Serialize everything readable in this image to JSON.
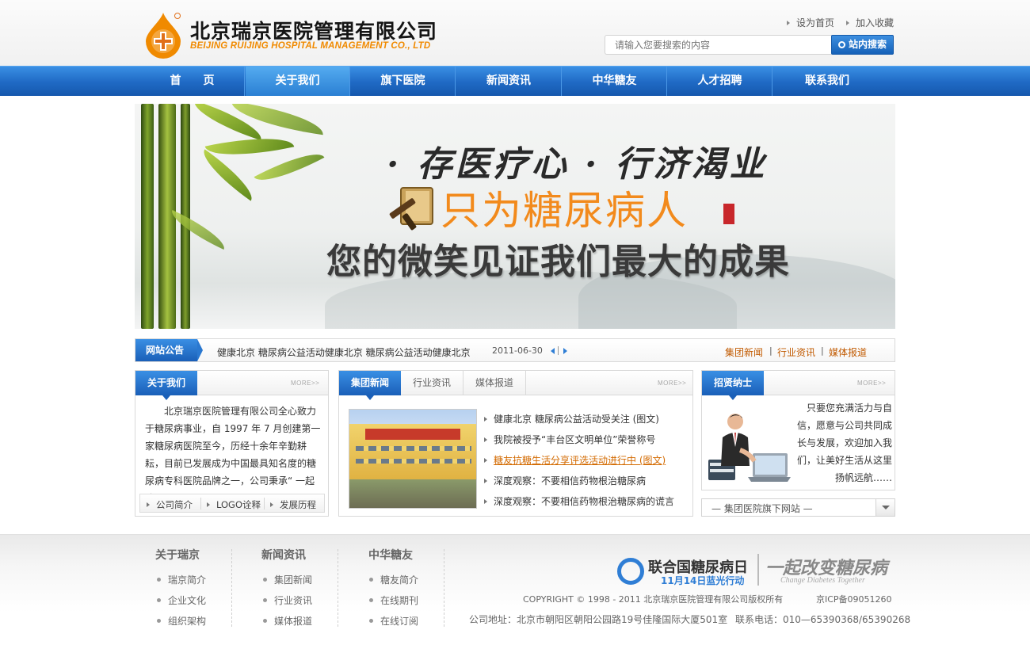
{
  "header": {
    "logo_cn": "北京瑞京医院管理有限公司",
    "logo_en": "BEIJING RUIJING HOSPITAL MANAGEMENT CO., LTD",
    "set_home": "设为首页",
    "bookmark": "加入收藏",
    "search_placeholder": "请输入您要搜索的内容",
    "search_button": "站内搜索"
  },
  "nav": [
    {
      "label": "首　　页"
    },
    {
      "label": "关于我们"
    },
    {
      "label": "旗下医院"
    },
    {
      "label": "新闻资讯"
    },
    {
      "label": "中华糖友"
    },
    {
      "label": "人才招聘"
    },
    {
      "label": "联系我们"
    }
  ],
  "nav_active_index": 1,
  "banner": {
    "line1": "· 存医疗心 · 行济渴业",
    "line2": "只为糖尿病人",
    "line3": "您的微笑见证我们最大的成果"
  },
  "notice": {
    "label": "网站公告",
    "text": "健康北京 糖尿病公益活动健康北京 糖尿病公益活动健康北京",
    "date": "2011-06-30",
    "links": [
      "集团新闻",
      "行业资讯",
      "媒体报道"
    ]
  },
  "about": {
    "title": "关于我们",
    "more": "MORE>>",
    "text": "北京瑞京医院管理有限公司全心致力于糖尿病事业，自 1997 年 7 月创建第一家糖尿病医院至今，历经十余年辛勤耕耘，目前已发展成为中国最具知名度的糖尿病专科医院品牌之一，公司秉承“ 一起改 . . .",
    "links": [
      "公司简介",
      "LOGO诠释",
      "发展历程"
    ]
  },
  "news": {
    "tabs": [
      "集团新闻",
      "行业资讯",
      "媒体报道"
    ],
    "more": "MORE>>",
    "items": [
      "健康北京 糖尿病公益活动受关注 (图文)",
      "我院被授予“丰台区文明单位”荣誉称号",
      "糖友抗糖生活分享评选活动进行中 (图文)",
      "深度观察：不要相信药物根治糖尿病",
      "深度观察：不要相信药物根治糖尿病的谎言"
    ],
    "highlight_index": 2
  },
  "recruit": {
    "title": "招贤纳士",
    "more": "MORE>>",
    "text": "只要您充满活力与自信，愿意与公司共同成长与发展，欢迎加入我们，让美好生活从这里扬帆远航……"
  },
  "site_select": {
    "label": "— 集团医院旗下网站 —"
  },
  "footer": {
    "columns": [
      {
        "title": "关于瑞京",
        "items": [
          "瑞京简介",
          "企业文化",
          "组织架构"
        ]
      },
      {
        "title": "新闻资讯",
        "items": [
          "集团新闻",
          "行业资讯",
          "媒体报道"
        ]
      },
      {
        "title": "中华糖友",
        "items": [
          "糖友简介",
          "在线期刊",
          "在线订阅"
        ]
      }
    ],
    "diabetes_day": "联合国糖尿病日",
    "diabetes_day_sub": "11月14日蓝光行动",
    "slogan": "一起改变糖尿病",
    "slogan_en": "Change Diabetes Together",
    "copyright": "COPYRIGHT © 1998 - 2011 北京瑞京医院管理有限公司版权所有",
    "icp": "京ICP备09051260",
    "address": "公司地址：北京市朝阳区朝阳公园路19号佳隆国际大厦501室",
    "phone": "联系电话：010—65390368/65390268"
  },
  "colors": {
    "brand_blue": "#1f69c4",
    "accent_orange": "#f08a00"
  }
}
